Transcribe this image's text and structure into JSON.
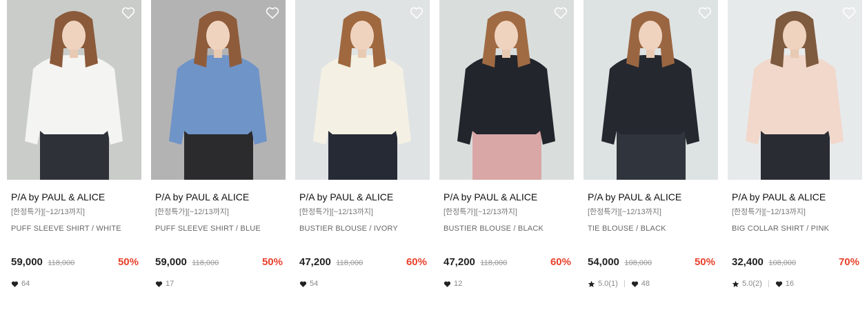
{
  "products": [
    {
      "brand": "P/A by PAUL & ALICE",
      "promo": "[한정특가][~12/13까지]",
      "name": "PUFF SLEEVE SHIRT / WHITE",
      "price": "59,000",
      "original_price": "118,000",
      "discount": "50%",
      "rating": "",
      "likes": "64",
      "colors": {
        "bg": "#c9ccc9",
        "top": "#f4f4f2",
        "bottom": "#2e3138",
        "hair": "#8a5a3a"
      }
    },
    {
      "brand": "P/A by PAUL & ALICE",
      "promo": "[한정특가][~12/13까지]",
      "name": "PUFF SLEEVE SHIRT / BLUE",
      "price": "59,000",
      "original_price": "118,000",
      "discount": "50%",
      "rating": "",
      "likes": "17",
      "colors": {
        "bg": "#b4b3b4",
        "top": "#6f94c8",
        "bottom": "#2b2b2e",
        "hair": "#8e5c3b"
      }
    },
    {
      "brand": "P/A by PAUL & ALICE",
      "promo": "[한정특가][~12/13까지]",
      "name": "BUSTIER BLOUSE / IVORY",
      "price": "47,200",
      "original_price": "118,000",
      "discount": "60%",
      "rating": "",
      "likes": "54",
      "colors": {
        "bg": "#dfe3e4",
        "top": "#f4f1e4",
        "bottom": "#262a35",
        "hair": "#a0683f"
      }
    },
    {
      "brand": "P/A by PAUL & ALICE",
      "promo": "[한정특가][~12/13까지]",
      "name": "BUSTIER BLOUSE / BLACK",
      "price": "47,200",
      "original_price": "118,000",
      "discount": "60%",
      "rating": "",
      "likes": "12",
      "colors": {
        "bg": "#d9dedd",
        "top": "#22252b",
        "bottom": "#d9a7a6",
        "hair": "#a06a43"
      }
    },
    {
      "brand": "P/A by PAUL & ALICE",
      "promo": "[한정특가][~12/13까지]",
      "name": "TIE BLOUSE / BLACK",
      "price": "54,000",
      "original_price": "108,000",
      "discount": "50%",
      "rating": "5.0(1)",
      "likes": "48",
      "colors": {
        "bg": "#dde2e2",
        "top": "#25282f",
        "bottom": "#30343c",
        "hair": "#9a6641"
      }
    },
    {
      "brand": "P/A by PAUL & ALICE",
      "promo": "[한정특가][~12/13까지]",
      "name": "BIG COLLAR SHIRT / PINK",
      "price": "32,400",
      "original_price": "108,000",
      "discount": "70%",
      "rating": "5.0(2)",
      "likes": "16",
      "colors": {
        "bg": "#e7eaeb",
        "top": "#f1d8cb",
        "bottom": "#2a2c33",
        "hair": "#7e5a3e"
      }
    }
  ],
  "accent_color": "#e8412c"
}
